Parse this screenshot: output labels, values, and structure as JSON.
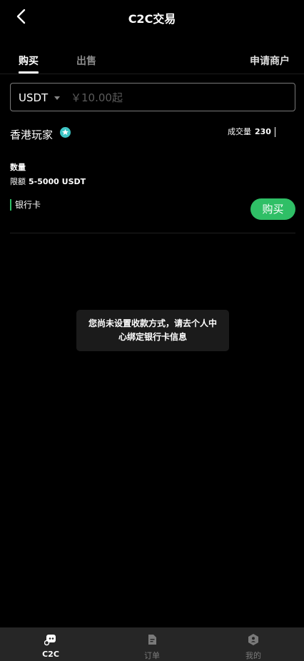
{
  "header": {
    "title": "C2C交易"
  },
  "tabs": {
    "buy": "购买",
    "sell": "出售",
    "apply_merchant": "申请商户"
  },
  "search": {
    "currency": "USDT",
    "placeholder": "￥10.00起"
  },
  "listing": {
    "merchant": "香港玩家",
    "volume_label": "成交量",
    "volume_value": "230",
    "quantity_label": "数量",
    "limit_label": "限额",
    "limit_value": "5-5000 USDT",
    "payment_method": "银行卡",
    "buy_button": "购买"
  },
  "toast": {
    "message": "您尚未设置收款方式，请去个人中心绑定银行卡信息"
  },
  "bottom_nav": {
    "c2c": "C2C",
    "orders": "订单",
    "me": "我的"
  },
  "colors": {
    "accent": "#2fbf66",
    "verified": "#3ec6c6",
    "background": "#000000",
    "nav_bg": "#262626"
  }
}
